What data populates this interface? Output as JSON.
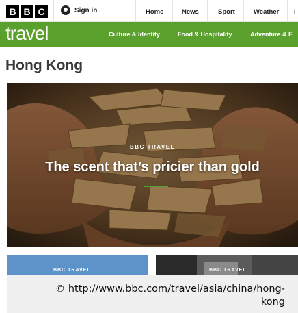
{
  "topbar": {
    "logo_letters": [
      "B",
      "B",
      "C"
    ],
    "signin_label": "Sign in",
    "nav": [
      "Home",
      "News",
      "Sport",
      "Weather"
    ],
    "nav_overflow": "i"
  },
  "travelbar": {
    "brand": "travel",
    "brand_color": "#5aa02c",
    "categories": [
      "Culture & Identity",
      "Food & Hospitality",
      "Adventure & E"
    ]
  },
  "page": {
    "title": "Hong Kong"
  },
  "hero": {
    "kicker": "BBC TRAVEL",
    "headline": "The scent that’s pricier than gold"
  },
  "cards": [
    {
      "kicker": "BBC TRAVEL"
    },
    {
      "kicker": "BBC TRAVEL"
    }
  ],
  "copyright": {
    "text": "© http://www.bbc.com/travel/asia/china/hong-kong"
  }
}
